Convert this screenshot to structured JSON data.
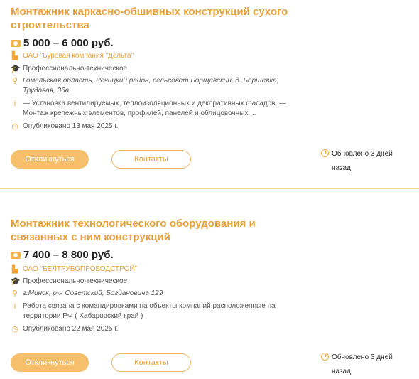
{
  "vacancies": [
    {
      "title": "Монтажник каркасно-обшивных конструкций сухого строительства",
      "salary": "5 000 – 6 000 руб.",
      "company": "ОАО \"Буровая компания \"Дельта\"",
      "education": "Профессионально-техническое",
      "address": "Гомельская область, Речицкий район, сельсовет Борщёвский, д. Борщёвка, Трудовая, 36а",
      "description": "— Установка вентилируемых, теплоизоляционных и декоративных фасадов. — Монтаж крепежных элементов, профилей, панелей и облицовочных ...",
      "published": "Опубликовано 13 мая 2025 г.",
      "apply_label": "Откликнуться",
      "contacts_label": "Контакты",
      "updated": "Обновлено 3 дней назад"
    },
    {
      "title": "Монтажник технологического оборудования и связанных с ним конструкций",
      "salary": "7 400 – 8 800 руб.",
      "company": "ОАО \"БЕЛТРУБОПРОВОДСТРОЙ\"",
      "education": "Профессионально-техническое",
      "address": "г.Минск, р-н Советский, Богдановича 129",
      "description": "Работа связана с командировками на объекты компаний расположенные на территории РФ ( Хабаровский край )",
      "published": "Опубликовано 22 мая 2025 г.",
      "apply_label": "Откликнуться",
      "contacts_label": "Контакты",
      "updated": "Обновлено 3 дней назад"
    }
  ],
  "icons": {
    "salary": "money-icon",
    "company": "factory-icon",
    "education": "graduation-cap-icon",
    "address": "location-pin-icon",
    "description": "info-icon",
    "published": "clock-icon"
  },
  "colors": {
    "accent": "#e8a13a",
    "button_fill": "#f5bf6c",
    "divider": "#f3d29b"
  }
}
